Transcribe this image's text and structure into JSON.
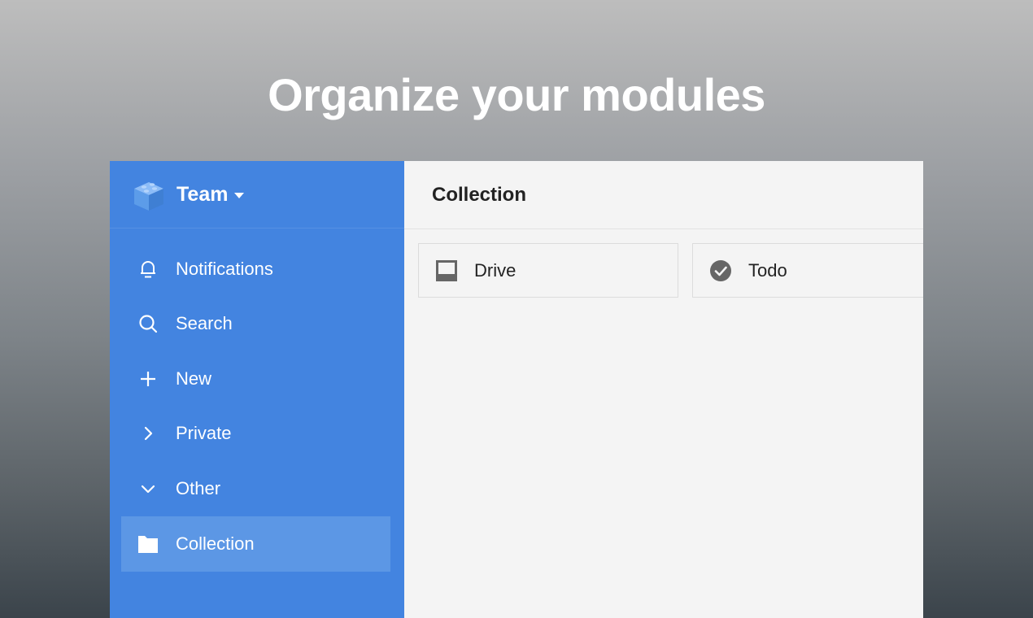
{
  "headline": "Organize your modules",
  "team": {
    "name": "Team"
  },
  "nav": {
    "notifications": "Notifications",
    "search": "Search",
    "new": "New",
    "private": "Private",
    "other": "Other",
    "collection": "Collection"
  },
  "main": {
    "title": "Collection",
    "cards": [
      {
        "label": "Drive",
        "icon": "drive-icon"
      },
      {
        "label": "Todo",
        "icon": "check-circle-icon"
      }
    ]
  },
  "colors": {
    "sidebar": "#4384e0",
    "sidebar_active": "#5c97e5",
    "main_bg": "#f4f4f4"
  }
}
